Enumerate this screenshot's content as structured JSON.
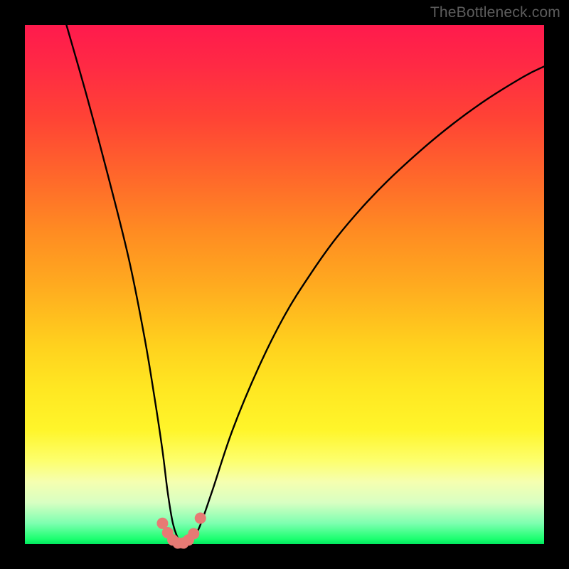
{
  "watermark": "TheBottleneck.com",
  "chart_data": {
    "type": "line",
    "title": "",
    "xlabel": "",
    "ylabel": "",
    "xlim": [
      0,
      100
    ],
    "ylim": [
      0,
      100
    ],
    "series": [
      {
        "name": "bottleneck-curve",
        "x": [
          8,
          12,
          16,
          20,
          23,
          25,
          26.5,
          27.5,
          28.5,
          29.5,
          30,
          31,
          32,
          33.5,
          36,
          40,
          45,
          50,
          55,
          60,
          66,
          72,
          80,
          88,
          96,
          100
        ],
        "values": [
          100,
          86,
          71,
          55,
          40,
          28,
          18,
          10,
          4,
          1,
          0,
          0,
          1,
          3,
          10,
          22,
          34,
          44,
          52,
          59,
          66,
          72,
          79,
          85,
          90,
          92
        ]
      }
    ],
    "markers": {
      "name": "bottom-dots",
      "color": "#e77a74",
      "points_x": [
        26.5,
        27.5,
        28.5,
        29.5,
        30.5,
        31.5,
        32.5,
        33.8
      ],
      "points_y": [
        4,
        2.2,
        0.8,
        0.2,
        0.2,
        0.8,
        2,
        5
      ]
    }
  }
}
